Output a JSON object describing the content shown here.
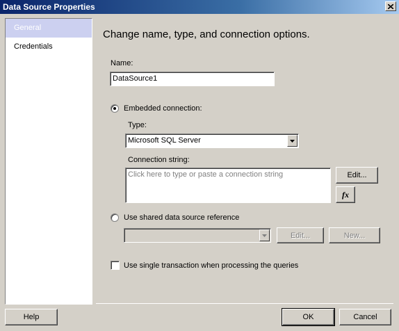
{
  "window": {
    "title": "Data Source Properties"
  },
  "sidebar": {
    "items": [
      {
        "label": "General",
        "selected": true
      },
      {
        "label": "Credentials",
        "selected": false
      }
    ]
  },
  "main": {
    "heading": "Change name, type, and connection options.",
    "name_label": "Name:",
    "name_value": "DataSource1",
    "embedded_label": "Embedded connection:",
    "embedded_selected": true,
    "type_label": "Type:",
    "type_value": "Microsoft SQL Server",
    "connstr_label": "Connection string:",
    "connstr_placeholder": "Click here to type or paste a connection string",
    "connstr_edit_label": "Edit...",
    "expression_icon_label": "fx",
    "shared_label": "Use shared data source reference",
    "shared_selected": false,
    "shared_value": "",
    "shared_edit_label": "Edit...",
    "shared_new_label": "New...",
    "single_tx_label": "Use single transaction when processing the queries",
    "single_tx_checked": false
  },
  "footer": {
    "help_label": "Help",
    "ok_label": "OK",
    "cancel_label": "Cancel"
  }
}
